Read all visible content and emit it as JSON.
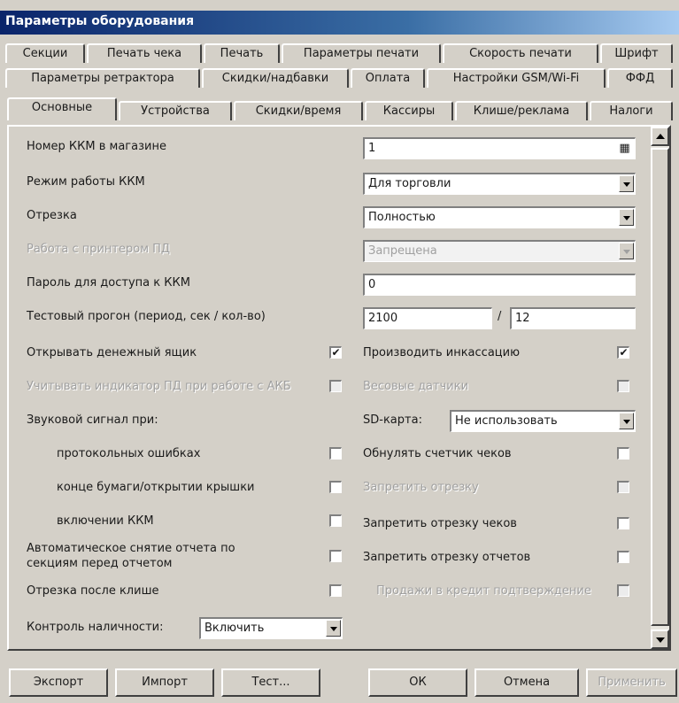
{
  "window": {
    "title": "Параметры оборудования"
  },
  "tabs": {
    "row1": [
      "Секции",
      "Печать чека",
      "Печать",
      "Параметры печати",
      "Скорость печати",
      "Шрифт"
    ],
    "row2": [
      "Параметры ретрактора",
      "Скидки/надбавки",
      "Оплата",
      "Настройки GSM/Wi-Fi",
      "ФФД"
    ],
    "row3": [
      "Основные",
      "Устройства",
      "Скидки/время",
      "Кассиры",
      "Клише/реклама",
      "Налоги"
    ]
  },
  "fields": {
    "kkm_number": {
      "label": "Номер ККМ в магазине",
      "value": "1"
    },
    "mode": {
      "label": "Режим работы ККМ",
      "value": "Для торговли"
    },
    "cutting": {
      "label": "Отрезка",
      "value": "Полностью"
    },
    "printer_pd": {
      "label": "Работа с принтером ПД",
      "value": "Запрещена"
    },
    "password": {
      "label": "Пароль для доступа к ККМ",
      "value": "0"
    },
    "test_run": {
      "label": "Тестовый прогон (период, сек / кол-во)",
      "value1": "2100",
      "separator": "/",
      "value2": "12"
    }
  },
  "left_checks": [
    {
      "label": "Открывать денежный ящик",
      "checked": true,
      "mark": "✔"
    },
    {
      "label": "Учитывать индикатор ПД при работе с АКБ",
      "checked": false,
      "disabled": true
    }
  ],
  "sound": {
    "label": "Звуковой сигнал при:",
    "items": [
      {
        "label": "протокольных ошибках",
        "checked": false
      },
      {
        "label": "конце бумаги/открытии крышки",
        "checked": false
      },
      {
        "label": "включении ККМ",
        "checked": false
      }
    ]
  },
  "auto_report": {
    "label_line1": "Автоматическое снятие отчета по",
    "label_line2": "секциям перед отчетом",
    "checked": false
  },
  "cut_after_cliche": {
    "label": "Отрезка после клише",
    "checked": false
  },
  "cash_control": {
    "label": "Контроль наличности:",
    "value": "Включить"
  },
  "right_checks": [
    {
      "label": "Производить инкассацию",
      "checked": true,
      "mark": "✔",
      "disabled": false
    },
    {
      "label": "Весовые датчики",
      "checked": false,
      "disabled": true
    },
    {
      "label": "Обнулять счетчик чеков",
      "checked": false,
      "disabled": false
    },
    {
      "label": "Запретить отрезку",
      "checked": false,
      "disabled": true
    },
    {
      "label": "Запретить отрезку чеков",
      "checked": false,
      "disabled": false
    },
    {
      "label": "Запретить отрезку отчетов",
      "checked": false,
      "disabled": false
    },
    {
      "label": "Продажи в кредит подтверждение",
      "checked": false,
      "disabled": true
    }
  ],
  "sd_card": {
    "label": "SD-карта:",
    "value": "Не использовать"
  },
  "buttons": {
    "export": "Экспорт",
    "import": "Импорт",
    "test": "Тест...",
    "ok": "ОК",
    "cancel": "Отмена",
    "apply": "Применить"
  },
  "icons": {
    "keypad": "keypad-icon",
    "dropdown": "chevron-down-icon",
    "scroll_up": "arrow-up-icon",
    "scroll_down": "arrow-down-icon"
  }
}
